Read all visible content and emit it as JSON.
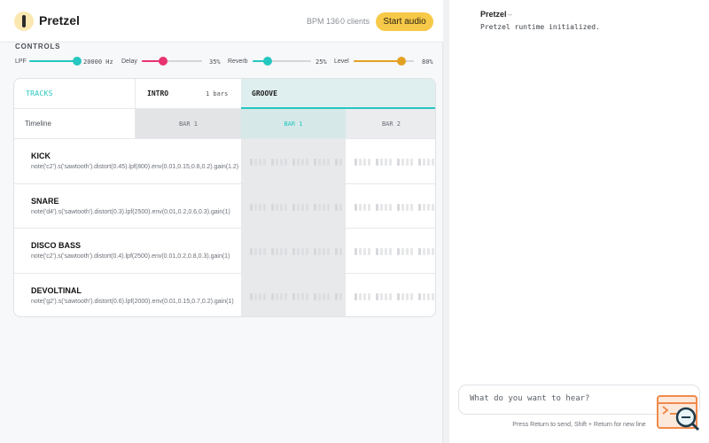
{
  "app": {
    "title": "Pretzel",
    "bpm": "BPM 136",
    "clients": "0 clients",
    "start_audio": "Start audio"
  },
  "controls": {
    "heading": "CONTROLS",
    "sliders": [
      {
        "label": "LPF",
        "value": "20000 Hz",
        "level": 1.0,
        "color": "#25c7c0"
      },
      {
        "label": "Delay",
        "value": "35%",
        "level": 0.35,
        "color": "#e8336f"
      },
      {
        "label": "Reverb",
        "value": "25%",
        "level": 0.25,
        "color": "#25c7c0"
      },
      {
        "label": "Level",
        "value": "80%",
        "level": 0.8,
        "color": "#e3a122"
      }
    ]
  },
  "sequencer": {
    "tracks_label": "TRACKS",
    "sections": [
      {
        "name": "INTRO",
        "bars": "1 bars"
      },
      {
        "name": "GROOVE",
        "active": true
      }
    ],
    "timeline_label": "Timeline",
    "bar_labels": [
      "BAR 1",
      "BAR 1",
      "BAR 2"
    ],
    "tracks": [
      {
        "name": "KICK",
        "code": "note('c2').s('sawtooth').distort(0.45).lpf(800).env(0.01,0.15,0.8,0.2).gain(1.2)"
      },
      {
        "name": "SNARE",
        "code": "note('d4').s('sawtooth').distort(0.3).lpf(2500).env(0.01,0.2,0.6,0.3).gain(1)"
      },
      {
        "name": "DISCO BASS",
        "code": "note('c2').s('sawtooth').distort(0.4).lpf(2500).env(0.01,0.2,0.8,0.3).gain(1)"
      },
      {
        "name": "DEVOLTINAL",
        "code": "note('g2').s('sawtooth').distort(0.6).lpf(2000).env(0.01,0.15,0.7,0.2).gain(1)"
      }
    ]
  },
  "assistant": {
    "name": "Pretzel",
    "dash": "–",
    "message": "Pretzel runtime initialized.",
    "placeholder": "What do you want to hear?",
    "hint": "Press Return to send, Shift + Return for new line"
  },
  "colors": {
    "accent": "#25c7c0",
    "button": "#f7c948",
    "groove_bg": "#dfeeee"
  }
}
